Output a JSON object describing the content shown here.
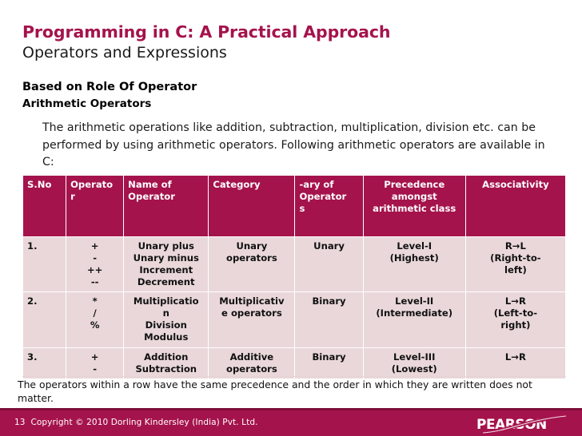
{
  "slide": {
    "main_title": "Programming in C: A Practical Approach",
    "sub_title": "Operators and Expressions",
    "heading_1": "Based on Role Of Operator",
    "heading_2": "Arithmetic Operators",
    "paragraph": "The arithmetic operations like addition, subtraction, multiplication, division etc. can be performed by using arithmetic operators. Following arithmetic operators are available in C:",
    "footnote": "The operators within a row have the same precedence and the order in which they are written does not matter."
  },
  "table": {
    "headers": {
      "sno": "S.No",
      "operator_l1": "Operato",
      "operator_l2": "r",
      "name_l1": "Name of",
      "name_l2": "Operator",
      "category": "Category",
      "ary_l1": "-ary of",
      "ary_l2": "Operator",
      "ary_l3": "s",
      "precedence_l1": "Precedence",
      "precedence_l2": "amongst",
      "precedence_l3": "arithmetic class",
      "associativity": "Associativity"
    },
    "rows": [
      {
        "sno": "1.",
        "operators": [
          "+",
          "-",
          "++",
          "--"
        ],
        "names": [
          "Unary plus",
          "Unary minus",
          "Increment",
          "Decrement"
        ],
        "category": [
          "Unary",
          "operators"
        ],
        "ary": [
          "Unary"
        ],
        "precedence": [
          "Level-I",
          "(Highest)"
        ],
        "associativity": [
          "R→L",
          "(Right-to-",
          "left)"
        ]
      },
      {
        "sno": "2.",
        "operators": [
          "*",
          "/",
          "%"
        ],
        "names": [
          "Multiplicatio",
          "n",
          "Division",
          "Modulus"
        ],
        "category": [
          "Multiplicativ",
          "e operators"
        ],
        "ary": [
          "Binary"
        ],
        "precedence": [
          "Level-II",
          "(Intermediate)"
        ],
        "associativity": [
          "L→R",
          "(Left-to-",
          "right)"
        ]
      },
      {
        "sno": "3.",
        "operators": [
          "+",
          "-"
        ],
        "names": [
          "Addition",
          "Subtraction"
        ],
        "category": [
          "Additive",
          "operators"
        ],
        "ary": [
          "Binary"
        ],
        "precedence": [
          "Level-III",
          "(Lowest)"
        ],
        "associativity": [
          "L→R"
        ]
      }
    ]
  },
  "footer": {
    "page_number": "13",
    "copyright": "Copyright © 2010 Dorling Kindersley (India) Pvt. Ltd.",
    "logo_text": "PEARSON"
  },
  "colors": {
    "brand_maroon": "#A5134C",
    "row_fill": "#E9D7DA",
    "footer_rule": "#7d0e39",
    "body_text": "#1a1a1a"
  }
}
